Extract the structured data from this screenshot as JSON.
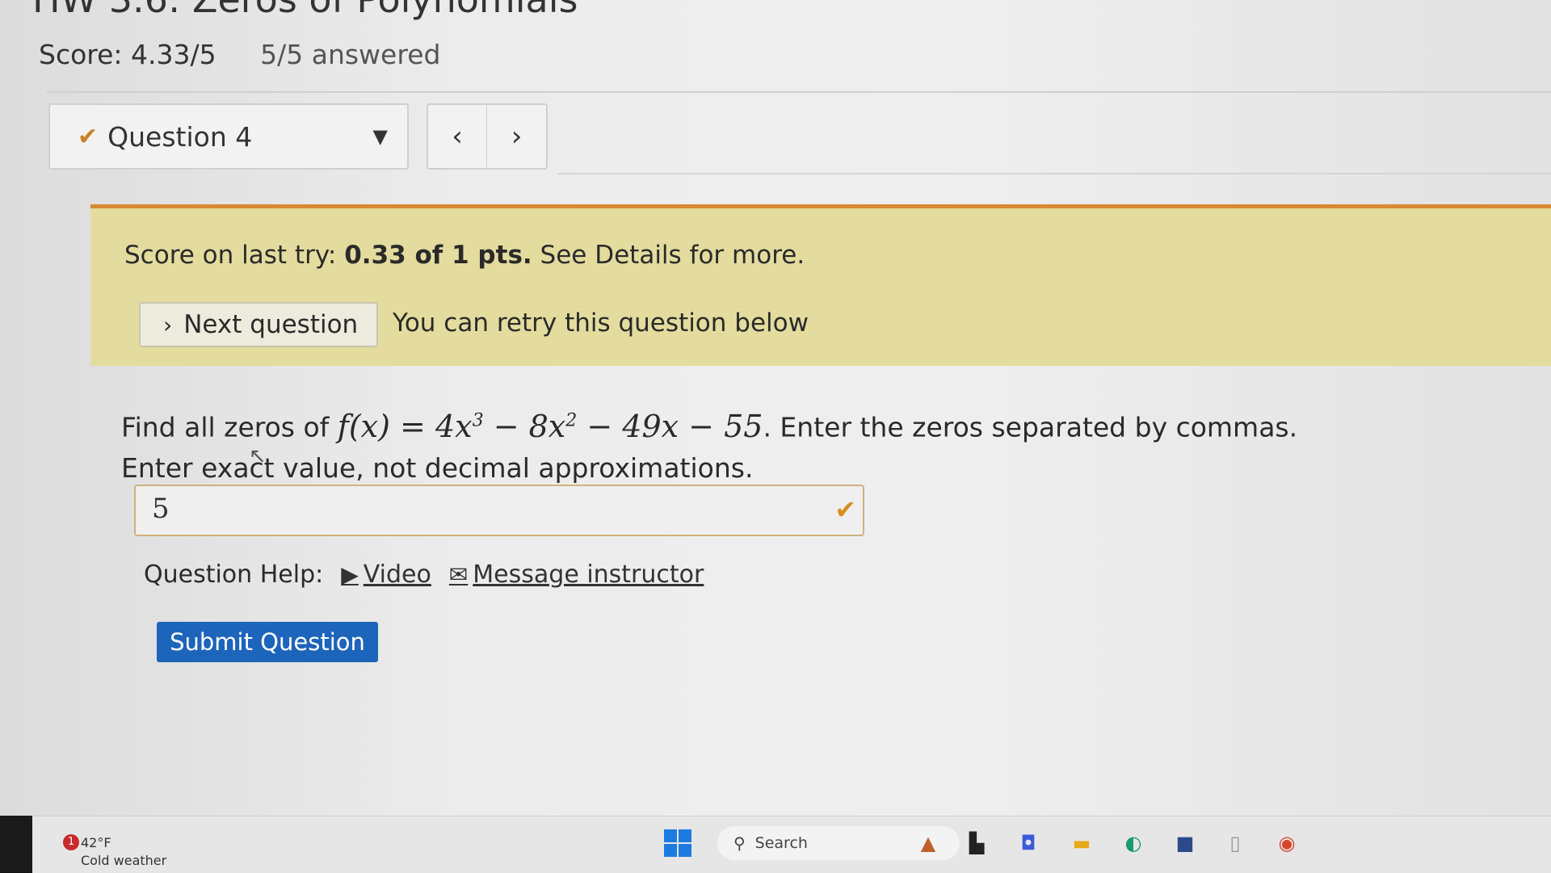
{
  "header": {
    "title": "HW 3.6: Zeros of Polynomials",
    "score": "Score: 4.33/5",
    "answered": "5/5 answered"
  },
  "question_nav": {
    "current": "Question 4",
    "status": "correct",
    "prev_icon": "chevron-left-icon",
    "next_icon": "chevron-right-icon"
  },
  "banner": {
    "score_prefix": "Score on last try:",
    "score_value": "0.33 of 1 pts.",
    "score_suffix": "See Details for more.",
    "next_button": "Next question",
    "retry_text": "You can retry this question below",
    "accent_color": "#d68a32",
    "background_color": "#e3dc9e"
  },
  "question": {
    "prefix": "Find all zeros of",
    "function_lhs": "f(x)",
    "equals": "=",
    "terms": {
      "t1_coef": "4x",
      "t1_exp": "3",
      "minus1": "−",
      "t2_coef": "8x",
      "t2_exp": "2",
      "minus2": "−",
      "t3": "49x",
      "minus3": "−",
      "t4": "55"
    },
    "suffix": ". Enter the zeros separated by commas.",
    "line2": "Enter exact value, not decimal approximations."
  },
  "answer": {
    "value": "5"
  },
  "help": {
    "label": "Question Help:",
    "video": "Video",
    "message": "Message instructor"
  },
  "submit_label": "Submit Question",
  "taskbar": {
    "weather_temp": "42°F",
    "weather_desc": "Cold weather",
    "weather_badge": "1",
    "search_label": "Search"
  }
}
